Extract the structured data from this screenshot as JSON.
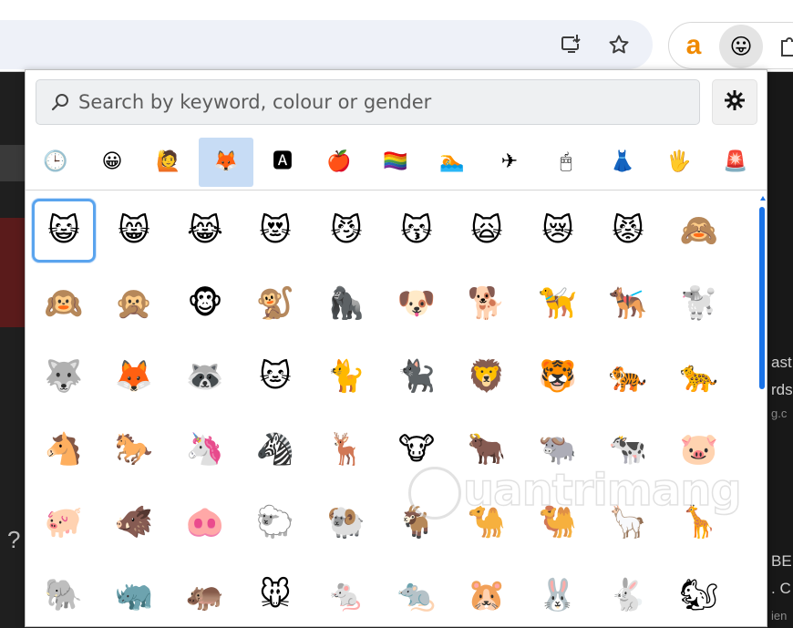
{
  "toolbar": {
    "install_icon": "install-app-icon",
    "bookmark_icon": "star-icon",
    "extensions": [
      {
        "name": "amazon-extension",
        "glyph": "a",
        "color": "#f08a00"
      },
      {
        "name": "emoji-extension",
        "glyph": "😛"
      }
    ],
    "puzzle_icon": "puzzle-icon"
  },
  "background_page": {
    "right_text": [
      "ast",
      "rds",
      "g.c",
      "BE",
      ". C",
      "ien"
    ],
    "left_text": "?"
  },
  "popup": {
    "search": {
      "placeholder": "Search by keyword, colour or gender",
      "value": ""
    },
    "settings_icon": "gear-icon",
    "categories": [
      {
        "name": "recent",
        "glyph": "🕒",
        "active": false
      },
      {
        "name": "smileys",
        "glyph": "😀",
        "active": false
      },
      {
        "name": "people",
        "glyph": "🙋",
        "active": false
      },
      {
        "name": "animals",
        "glyph": "🦊",
        "active": true
      },
      {
        "name": "symbols",
        "glyph": "🅰",
        "active": false
      },
      {
        "name": "food",
        "glyph": "🍎",
        "active": false
      },
      {
        "name": "flags",
        "glyph": "🏳️‍🌈",
        "active": false
      },
      {
        "name": "activities",
        "glyph": "🏊",
        "active": false
      },
      {
        "name": "travel",
        "glyph": "✈",
        "active": false
      },
      {
        "name": "objects",
        "glyph": "🖱",
        "active": false
      },
      {
        "name": "clothing",
        "glyph": "👗",
        "active": false
      },
      {
        "name": "hands",
        "glyph": "🖐",
        "active": false
      },
      {
        "name": "alerts",
        "glyph": "🚨",
        "active": false
      }
    ],
    "selected_emoji_index": 0,
    "emojis": [
      "😺",
      "😸",
      "😹",
      "😻",
      "😼",
      "😽",
      "🙀",
      "😿",
      "😾",
      "🙈",
      "🙉",
      "🙊",
      "🐵",
      "🐒",
      "🦍",
      "🐶",
      "🐕",
      "🦮",
      "🐕‍🦺",
      "🐩",
      "🐺",
      "🦊",
      "🦝",
      "🐱",
      "🐈",
      "🐈‍⬛",
      "🦁",
      "🐯",
      "🐅",
      "🐆",
      "🐴",
      "🐎",
      "🦄",
      "🦓",
      "🦌",
      "🐮",
      "🐂",
      "🐃",
      "🐄",
      "🐷",
      "🐖",
      "🐗",
      "🐽",
      "🐑",
      "🐏",
      "🐐",
      "🐪",
      "🐫",
      "🦙",
      "🦒",
      "🐘",
      "🦏",
      "🦛",
      "🐭",
      "🐁",
      "🐀",
      "🐹",
      "🐰",
      "🐇",
      "🐿"
    ],
    "scroll_position": 0.05,
    "accent": "#1a73e8"
  },
  "watermark": {
    "text": "uantrimang"
  }
}
